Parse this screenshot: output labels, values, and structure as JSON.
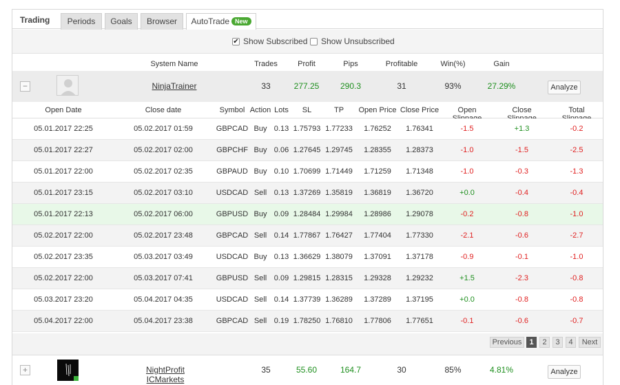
{
  "tabs": {
    "title": "Trading",
    "items": [
      "Periods",
      "Goals",
      "Browser",
      "AutoTrade"
    ],
    "new_badge": "New"
  },
  "filters": {
    "show_subscribed": "Show Subscribed",
    "show_unsubscribed": "Show Unsubscribed",
    "subscribed_checked": true,
    "unsubscribed_checked": false
  },
  "system_header": {
    "name": "System Name",
    "trades": "Trades",
    "profit": "Profit",
    "pips": "Pips",
    "profitable": "Profitable",
    "win": "Win(%)",
    "gain": "Gain"
  },
  "systems": [
    {
      "toggle": "−",
      "name": "NinjaTrainer",
      "trades": "33",
      "profit": "277.25",
      "pips": "290.3",
      "profitable": "31",
      "win": "93%",
      "gain": "27.29%",
      "analyze": "Analyze"
    },
    {
      "toggle": "+",
      "name": "NightProfit ICMarkets",
      "trades": "35",
      "profit": "55.60",
      "pips": "164.7",
      "profitable": "30",
      "win": "85%",
      "gain": "4.81%",
      "analyze": "Analyze"
    }
  ],
  "trade_header": {
    "open_date": "Open Date",
    "close_date": "Close date",
    "symbol": "Symbol",
    "action": "Action",
    "lots": "Lots",
    "sl": "SL",
    "tp": "TP",
    "open_price": "Open Price",
    "close_price": "Close Price",
    "open_slippage": "Open Slippage",
    "close_slippage": "Close Slippage",
    "total_slippage": "Total Slippage"
  },
  "trades": [
    {
      "open": "05.01.2017 22:25",
      "close": "05.02.2017 01:59",
      "symbol": "GBPCAD",
      "action": "Buy",
      "lots": "0.13",
      "sl": "1.75793",
      "tp": "1.77233",
      "op": "1.76252",
      "cp": "1.76341",
      "os": "-1.5",
      "cs": "+1.3",
      "ts": "-0.2"
    },
    {
      "open": "05.01.2017 22:27",
      "close": "05.02.2017 02:00",
      "symbol": "GBPCHF",
      "action": "Buy",
      "lots": "0.06",
      "sl": "1.27645",
      "tp": "1.29745",
      "op": "1.28355",
      "cp": "1.28373",
      "os": "-1.0",
      "cs": "-1.5",
      "ts": "-2.5"
    },
    {
      "open": "05.01.2017 22:00",
      "close": "05.02.2017 02:35",
      "symbol": "GBPAUD",
      "action": "Buy",
      "lots": "0.10",
      "sl": "1.70699",
      "tp": "1.71449",
      "op": "1.71259",
      "cp": "1.71348",
      "os": "-1.0",
      "cs": "-0.3",
      "ts": "-1.3"
    },
    {
      "open": "05.01.2017 23:15",
      "close": "05.02.2017 03:10",
      "symbol": "USDCAD",
      "action": "Sell",
      "lots": "0.13",
      "sl": "1.37269",
      "tp": "1.35819",
      "op": "1.36819",
      "cp": "1.36720",
      "os": "+0.0",
      "cs": "-0.4",
      "ts": "-0.4"
    },
    {
      "open": "05.01.2017 22:13",
      "close": "05.02.2017 06:00",
      "symbol": "GBPUSD",
      "action": "Buy",
      "lots": "0.09",
      "sl": "1.28484",
      "tp": "1.29984",
      "op": "1.28986",
      "cp": "1.29078",
      "os": "-0.2",
      "cs": "-0.8",
      "ts": "-1.0"
    },
    {
      "open": "05.02.2017 22:00",
      "close": "05.02.2017 23:48",
      "symbol": "GBPCAD",
      "action": "Sell",
      "lots": "0.14",
      "sl": "1.77867",
      "tp": "1.76427",
      "op": "1.77404",
      "cp": "1.77330",
      "os": "-2.1",
      "cs": "-0.6",
      "ts": "-2.7"
    },
    {
      "open": "05.02.2017 23:35",
      "close": "05.03.2017 03:49",
      "symbol": "USDCAD",
      "action": "Buy",
      "lots": "0.13",
      "sl": "1.36629",
      "tp": "1.38079",
      "op": "1.37091",
      "cp": "1.37178",
      "os": "-0.9",
      "cs": "-0.1",
      "ts": "-1.0"
    },
    {
      "open": "05.02.2017 22:00",
      "close": "05.03.2017 07:41",
      "symbol": "GBPUSD",
      "action": "Sell",
      "lots": "0.09",
      "sl": "1.29815",
      "tp": "1.28315",
      "op": "1.29328",
      "cp": "1.29232",
      "os": "+1.5",
      "cs": "-2.3",
      "ts": "-0.8"
    },
    {
      "open": "05.03.2017 23:20",
      "close": "05.04.2017 04:35",
      "symbol": "USDCAD",
      "action": "Sell",
      "lots": "0.14",
      "sl": "1.37739",
      "tp": "1.36289",
      "op": "1.37289",
      "cp": "1.37195",
      "os": "+0.0",
      "cs": "-0.8",
      "ts": "-0.8"
    },
    {
      "open": "05.04.2017 22:00",
      "close": "05.04.2017 23:38",
      "symbol": "GBPCAD",
      "action": "Sell",
      "lots": "0.19",
      "sl": "1.78250",
      "tp": "1.76810",
      "op": "1.77806",
      "cp": "1.77651",
      "os": "-0.1",
      "cs": "-0.6",
      "ts": "-0.7"
    }
  ],
  "pager": {
    "previous": "Previous",
    "pages": [
      "1",
      "2",
      "3",
      "4"
    ],
    "current": "1",
    "next": "Next"
  },
  "colors": {
    "positive": "#1e8f1e",
    "negative": "#e02020",
    "highlight_row": "#e8f8e8",
    "badge": "#4aa832"
  },
  "icons": {
    "collapse": "minus-icon",
    "expand": "plus-icon",
    "checkbox_checked": "check-icon",
    "avatar1": "user-placeholder-icon",
    "avatar2": "system-logo-icon"
  }
}
